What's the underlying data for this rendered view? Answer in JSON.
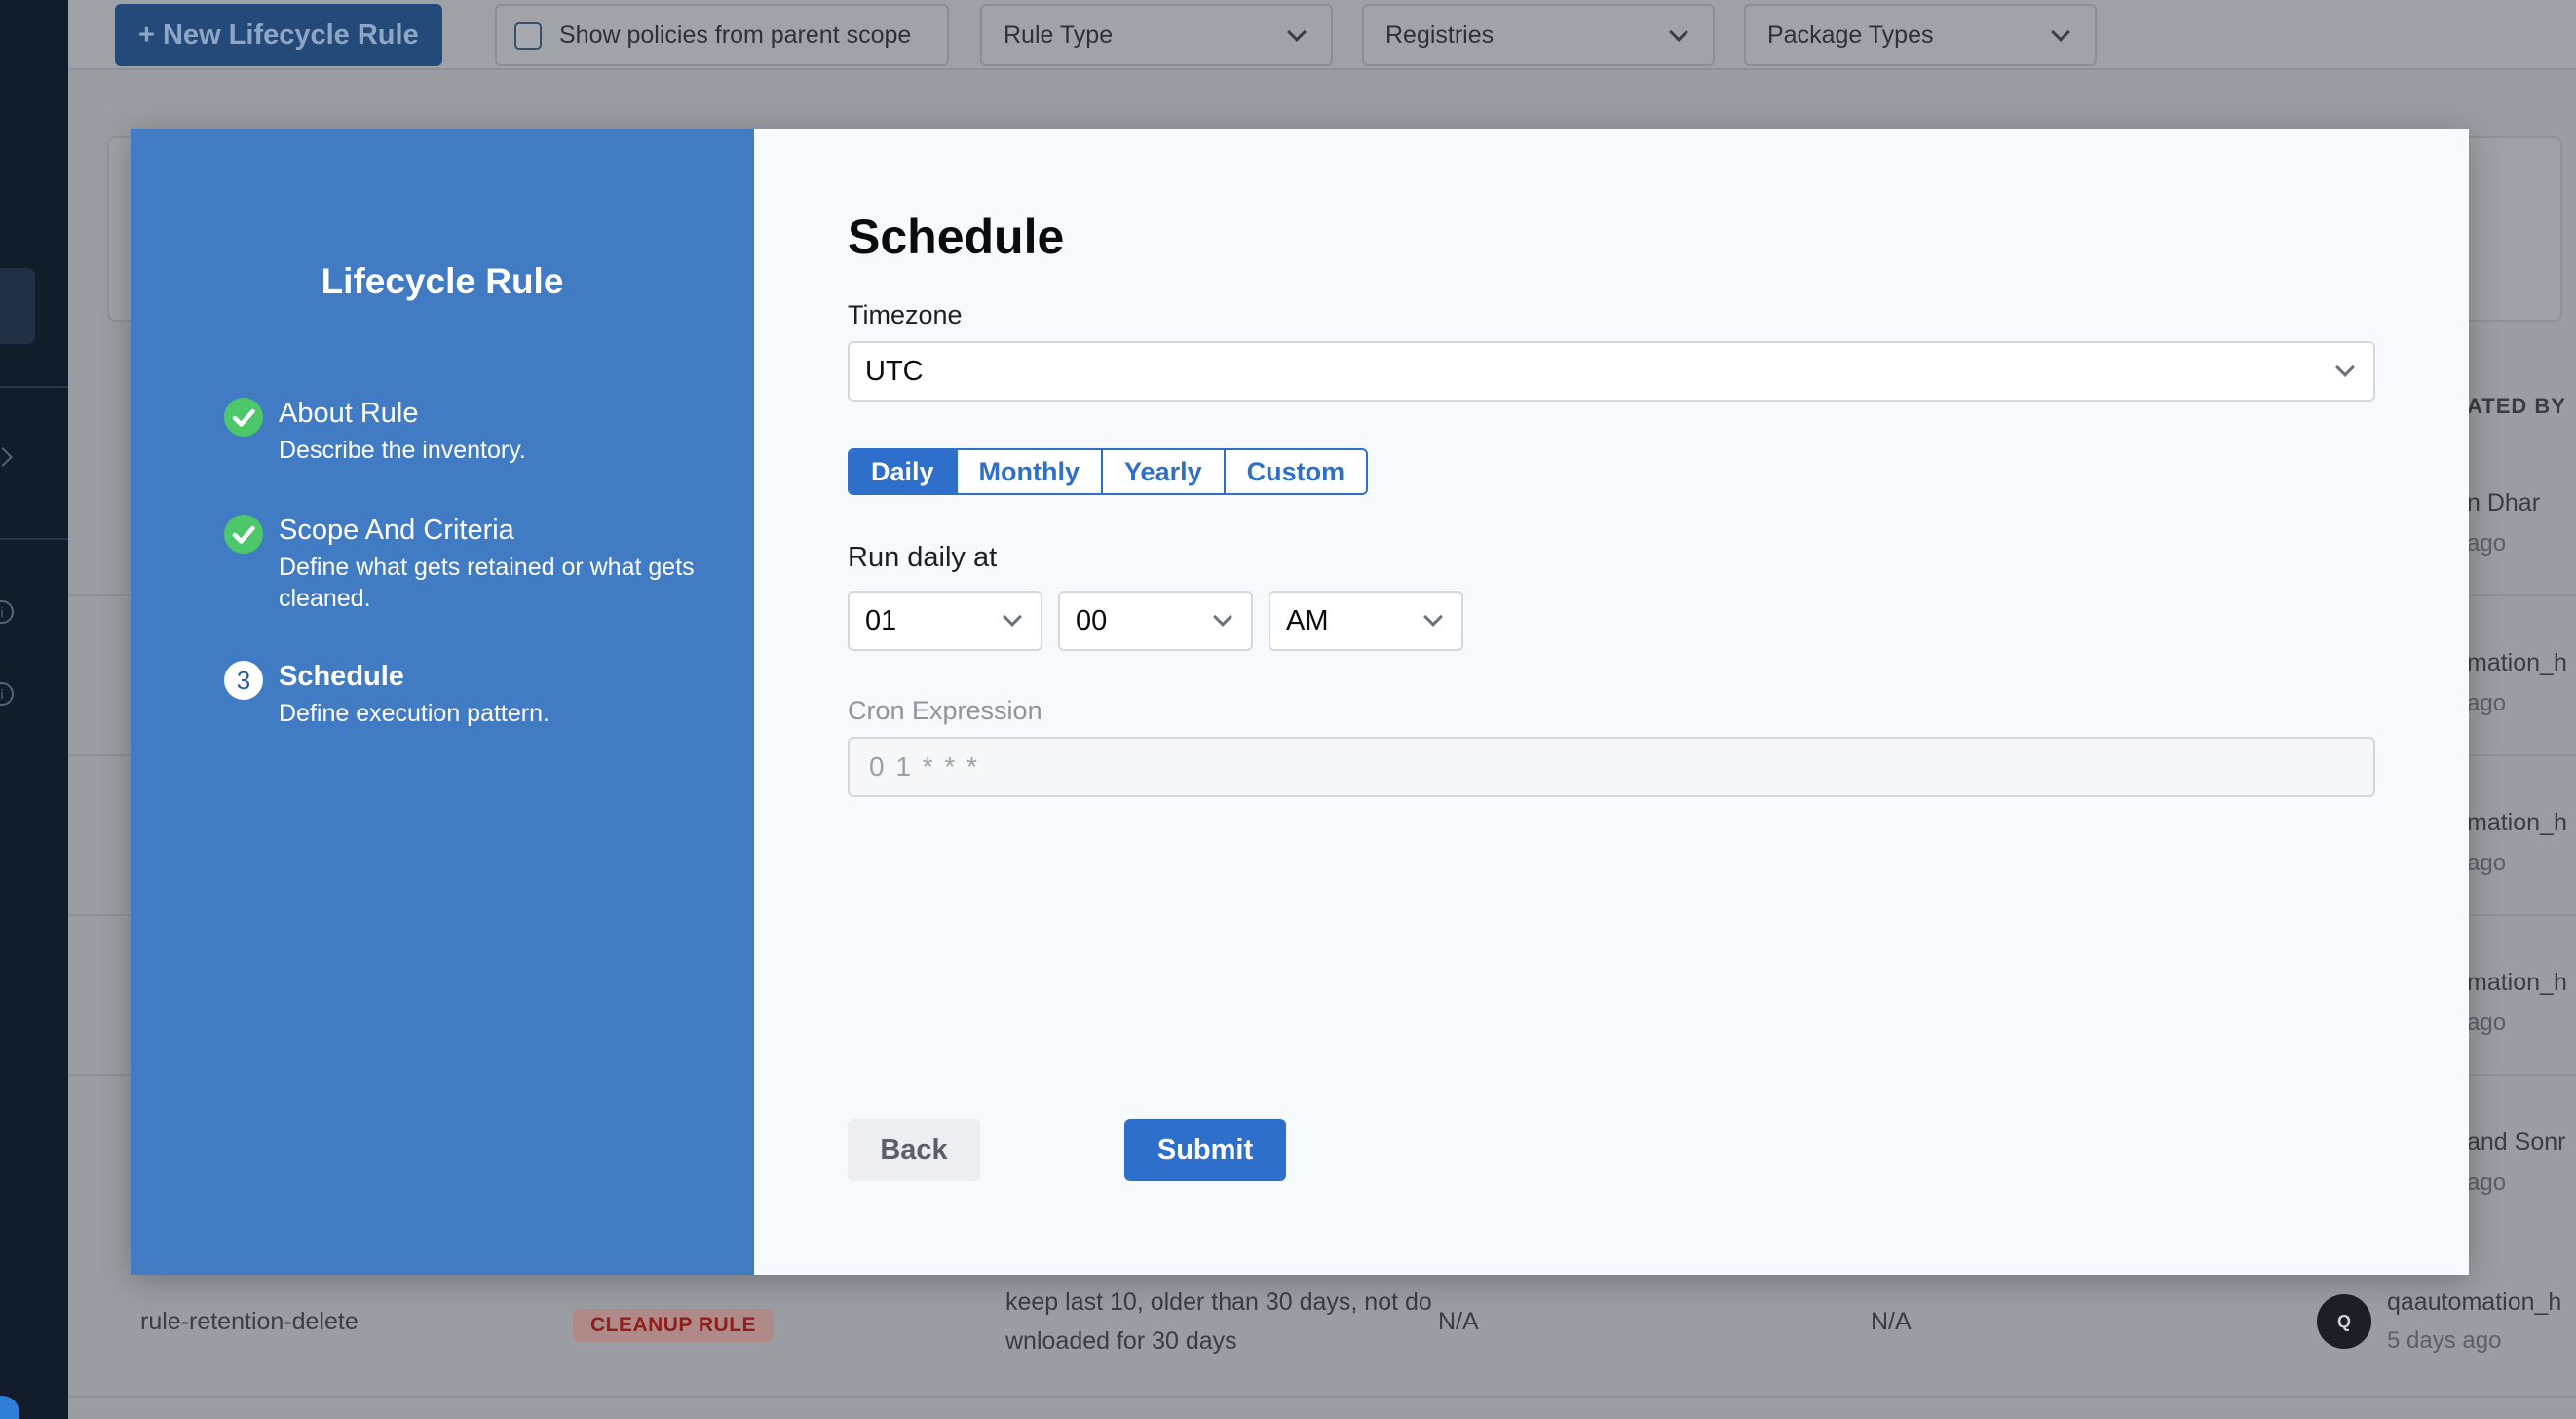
{
  "background": {
    "toolbar": {
      "new_rule_label": "+ New Lifecycle Rule",
      "parent_scope_label": "Show policies from parent scope",
      "rule_type_label": "Rule Type",
      "registries_label": "Registries",
      "package_types_label": "Package Types"
    },
    "table": {
      "created_by_header": "ATED BY",
      "rows": [
        {
          "user": "n Dhar",
          "time": "ago"
        },
        {
          "user": "mation_h",
          "time": "ago"
        },
        {
          "user": "mation_h",
          "time": "ago"
        },
        {
          "user": "mation_h",
          "time": "ago"
        },
        {
          "user": "and Sonr",
          "time": "ago"
        }
      ],
      "last_row": {
        "name": "rule-retention-delete",
        "badge": "CLEANUP RULE",
        "description_line1": "keep last 10, older than 30 days, not do",
        "description_line2": "wnloaded for 30 days",
        "col_a": "N/A",
        "col_b": "N/A",
        "avatar_initial": "Q",
        "user": "qaautomation_h",
        "time": "5 days ago"
      }
    }
  },
  "modal": {
    "sidebar": {
      "title": "Lifecycle Rule",
      "steps": [
        {
          "title": "About Rule",
          "description": "Describe the inventory.",
          "state": "done"
        },
        {
          "title": "Scope And Criteria",
          "description": "Define what gets retained or what gets cleaned.",
          "state": "done"
        },
        {
          "number": "3",
          "title": "Schedule",
          "description": "Define execution pattern.",
          "state": "current"
        }
      ]
    },
    "form": {
      "heading": "Schedule",
      "timezone_label": "Timezone",
      "timezone_value": "UTC",
      "frequency_tabs": [
        "Daily",
        "Monthly",
        "Yearly",
        "Custom"
      ],
      "active_tab": "Daily",
      "run_label": "Run daily at",
      "hour_value": "01",
      "minute_value": "00",
      "meridiem_value": "AM",
      "cron_label": "Cron Expression",
      "cron_value": "0 1 * * *",
      "back_label": "Back",
      "submit_label": "Submit"
    }
  },
  "colors": {
    "sidebar_bg": "#417bc4",
    "primary": "#2f6fcc",
    "success": "#4cc76a",
    "nav_bg": "#121d2c"
  }
}
